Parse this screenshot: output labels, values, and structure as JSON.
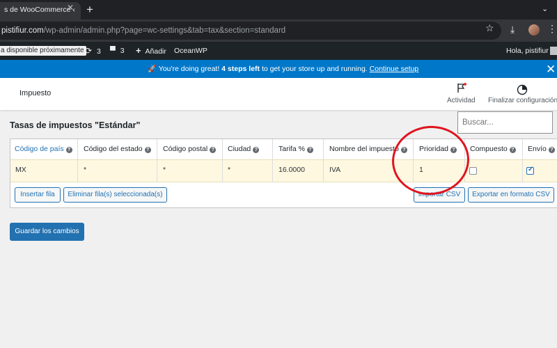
{
  "browser": {
    "tab_title": "s de WooCommerce ‹",
    "url_host": "pistifiur.com",
    "url_path": "/wp-admin/admin.php?page=wc-settings&tab=tax&section=standard"
  },
  "adminbar": {
    "site": "a disponible próximamente",
    "updates_count": "3",
    "comments_count": "3",
    "new_label": "Añadir",
    "theme_label": "OceanWP",
    "greeting": "Hola, pistifiur"
  },
  "notice": {
    "emoji": "🚀",
    "prefix": " You're doing great! ",
    "bold": "4 steps left",
    "middle": " to get your store up and running. ",
    "link": "Continue setup"
  },
  "wc_header": {
    "title": "Impuesto",
    "activity_label": "Actividad",
    "finish_label": "Finalizar configuración"
  },
  "page": {
    "title": "Tasas de impuestos \"Estándar\"",
    "search_placeholder": "Buscar..."
  },
  "table": {
    "headers": [
      "Código de país",
      "Código del estado",
      "Código postal",
      "Ciudad",
      "Tarifa %",
      "Nombre del impuesto",
      "Prioridad",
      "Compuesto",
      "Envío"
    ],
    "row": {
      "country": "MX",
      "state": "*",
      "postcode": "*",
      "city": "*",
      "rate": "16.0000",
      "name": "IVA",
      "priority": "1",
      "compound": false,
      "shipping": true
    }
  },
  "buttons": {
    "insert_row": "Insertar fila",
    "delete_rows": "Eliminar fila(s) seleccionada(s)",
    "import_csv": "Importar CSV",
    "export_csv": "Exportar en formato CSV",
    "save": "Guardar los cambios"
  },
  "colors": {
    "notice_bg": "#0077c8",
    "primary": "#2271b1",
    "row_highlight": "#fff8e1",
    "annotation": "#e0141e"
  }
}
